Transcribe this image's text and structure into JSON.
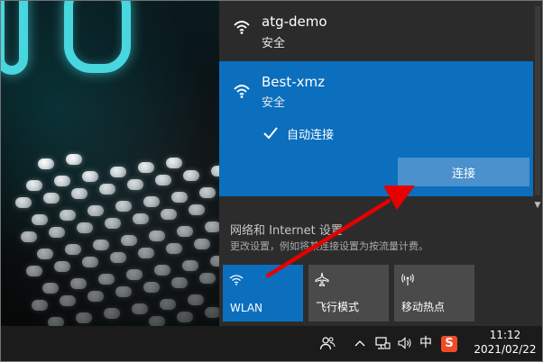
{
  "networks": [
    {
      "name": "atg-demo",
      "status": "安全"
    },
    {
      "name": "Best-xmz",
      "status": "安全",
      "auto_connect_label": "自动连接",
      "auto_connect_checked": true,
      "connect_label": "连接"
    }
  ],
  "settings": {
    "title": "网络和 Internet 设置",
    "subtitle": "更改设置，例如将某连接设置为按流量计费。"
  },
  "quick_actions": [
    {
      "label": "WLAN",
      "icon": "wifi-icon",
      "active": true
    },
    {
      "label": "飞行模式",
      "icon": "airplane-icon",
      "active": false
    },
    {
      "label": "移动热点",
      "icon": "hotspot-icon",
      "active": false
    }
  ],
  "taskbar": {
    "ime_mode": "中",
    "ime_badge": "S",
    "time": "11:12",
    "date": "2021/02/22"
  },
  "colors": {
    "accent": "#0b6fbe",
    "panel": "#2c2c2c",
    "tile": "#4a4a4a",
    "connect_button": "#4a91cd",
    "arrow": "#e60000",
    "ime_badge": "#f24a27"
  }
}
